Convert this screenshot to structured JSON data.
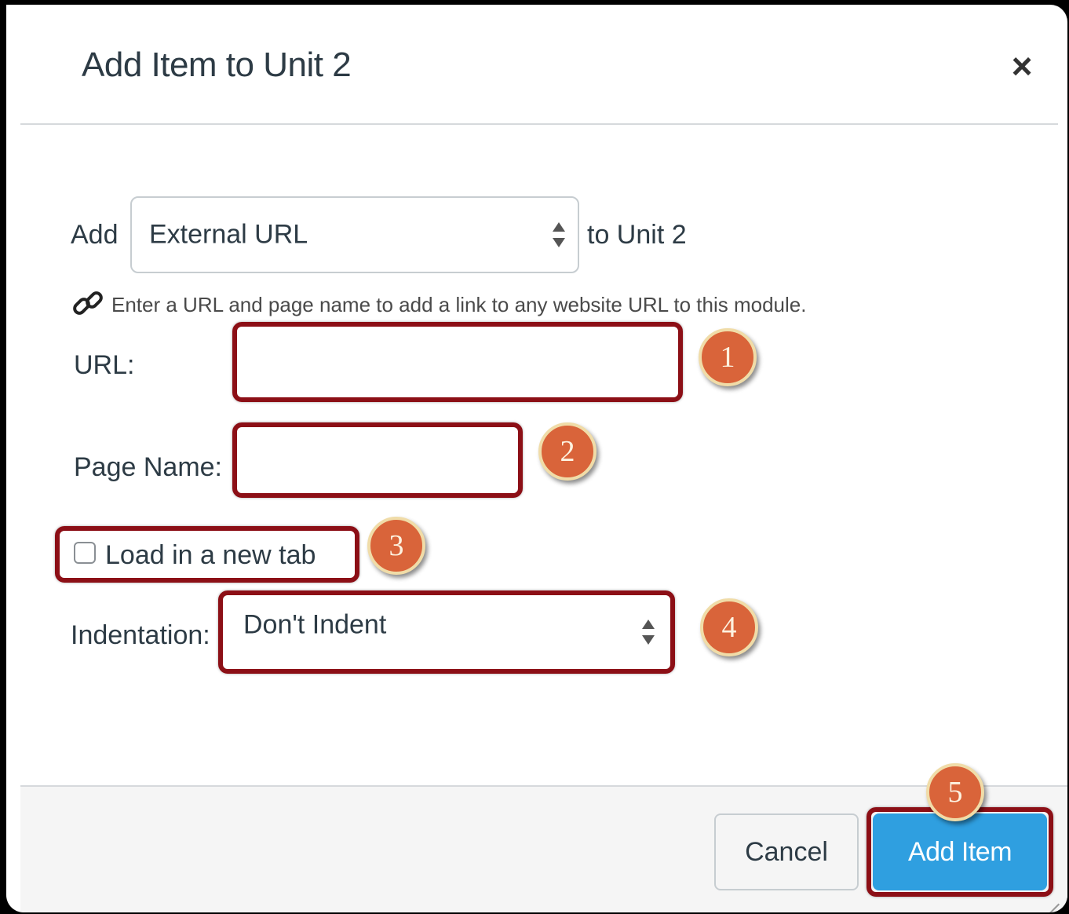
{
  "dialog": {
    "title": "Add Item to Unit 2",
    "close_symbol": "×"
  },
  "add_row": {
    "prefix": "Add",
    "item_type_selected": "External URL",
    "suffix": "to Unit 2"
  },
  "hint": {
    "icon": "link-icon",
    "text": "Enter a URL and page name to add a link to any website URL to this module."
  },
  "form": {
    "url_label": "URL:",
    "url_value": "",
    "page_name_label": "Page Name:",
    "page_name_value": "",
    "new_tab_label": "Load in a new tab",
    "new_tab_checked": false,
    "indentation_label": "Indentation:",
    "indentation_selected": "Don't Indent"
  },
  "callouts": [
    "1",
    "2",
    "3",
    "4",
    "5"
  ],
  "footer": {
    "cancel_label": "Cancel",
    "add_label": "Add Item"
  },
  "colors": {
    "highlight": "#8c0f16",
    "badge": "#d9643a",
    "primary_button": "#2f9fe0"
  }
}
